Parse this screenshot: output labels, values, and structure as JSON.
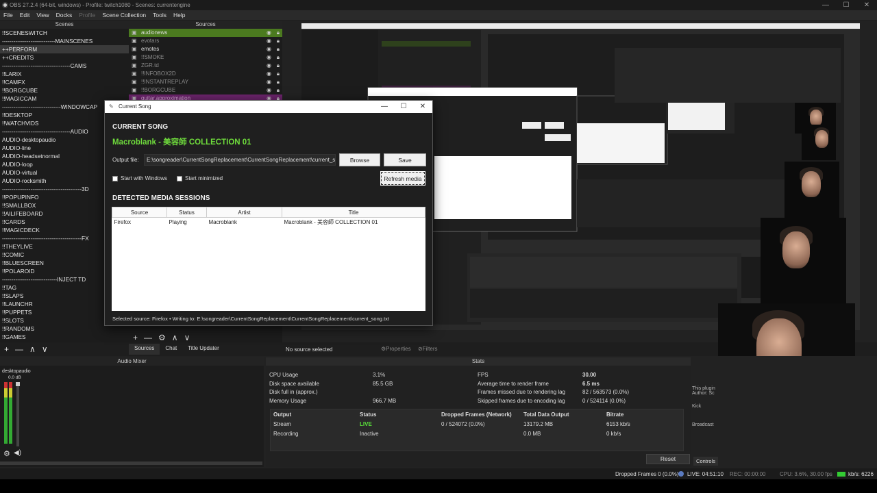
{
  "window": {
    "title": "OBS 27.2.4 (64-bit, windows) - Profile: twitch1080 - Scenes: currentengine",
    "minimize_glyph": "—",
    "maximize_glyph": "☐",
    "close_glyph": "✕"
  },
  "menu": [
    "File",
    "Edit",
    "View",
    "Docks",
    "Profile",
    "Scene Collection",
    "Tools",
    "Help"
  ],
  "scenes": {
    "header": "Scenes",
    "items": [
      "!!SCENESWITCH",
      "----------------------------MAINSCENES",
      "++PERFORM",
      "++CREDITS",
      "------------------------------------CAMS",
      "!!LARIX",
      "!!CAMFX",
      "!!BORGCUBE",
      "!!MAGICCAM",
      "-------------------------------WINDOWCAP",
      "!!DESKTOP",
      "!!WATCHVIDS",
      "------------------------------------AUDIO",
      "AUDIO-desktopaudio",
      "AUDIO-line",
      "AUDIO-headsetnormal",
      "AUDIO-loop",
      "AUDIO-virtual",
      "AUDIO-rocksmith",
      "------------------------------------------3D",
      "!!POPUPINFO",
      "!!SMALLBOX",
      "!!AILIFEBOARD",
      "!!CARDS",
      "!!MAGICDECK",
      "------------------------------------------FX",
      "!!THEYLIVE",
      "!!COMIC",
      "!!BLUESCREEN",
      "!!POLAROID",
      "-----------------------------INJECT TD",
      "!!TAG",
      "!!SLAPS",
      "!!LAUNCHR",
      "!!PUPPETS",
      "!!SLOTS",
      "!!RANDOMS",
      "!!GAMES"
    ],
    "selected_index": 2
  },
  "sources": {
    "header": "Sources",
    "items": [
      {
        "label": "audionews",
        "style": "green"
      },
      {
        "label": "evotars",
        "style": "dim"
      },
      {
        "label": "emotes",
        "style": "normal"
      },
      {
        "label": "!!SMOKE",
        "style": "dim"
      },
      {
        "label": "ZGR.td",
        "style": "dim"
      },
      {
        "label": "!!INFOBOX2D",
        "style": "dim"
      },
      {
        "label": "!!INSTANTREPLAY",
        "style": "dim"
      },
      {
        "label": "!!BORGCUBE",
        "style": "dim"
      },
      {
        "label": "guitar.approximation",
        "style": "purple"
      }
    ]
  },
  "dialog": {
    "title": "Current Song",
    "heading": "CURRENT SONG",
    "now_playing": "Macroblank - 美容師 COLLECTION 01",
    "output_label": "Output file:",
    "output_value": "E:\\songreader\\CurrentSongReplacement\\CurrentSongReplacement\\current_so",
    "browse": "Browse",
    "save": "Save",
    "start_windows": "Start with Windows",
    "start_minimized": "Start minimized",
    "refresh": "Refresh media",
    "sessions_heading": "DETECTED MEDIA SESSIONS",
    "columns": [
      "Source",
      "Status",
      "Artist",
      "Title"
    ],
    "rows": [
      {
        "source": "Firefox",
        "status": "Playing",
        "artist": "Macroblank",
        "title": "Macroblank - 美容師 COLLECTION 01"
      }
    ],
    "footer": "Selected source: Firefox  •  Writing to: E:\\songreader\\CurrentSongReplacement\\CurrentSongReplacement\\current_song.txt"
  },
  "source_toolbar": {
    "add": "+",
    "remove": "—",
    "settings": "⚙",
    "up": "∧",
    "down": "∨"
  },
  "scene_toolbar": {
    "add": "+",
    "remove": "—",
    "up": "∧",
    "down": "∨"
  },
  "dock_tabs": [
    "Sources",
    "Chat",
    "Title Updater"
  ],
  "no_source": "No source selected",
  "properties": "Properties",
  "filters": "Filters",
  "audio_mixer": {
    "header": "Audio Mixer",
    "channel": "desktopaudio",
    "level": "0.0 dB"
  },
  "stats": {
    "header": "Stats",
    "left": [
      {
        "label": "CPU Usage",
        "value": "3.1%"
      },
      {
        "label": "Disk space available",
        "value": "85.5 GB"
      },
      {
        "label": "Disk full in (approx.)",
        "value": ""
      },
      {
        "label": "Memory Usage",
        "value": "966.7 MB"
      }
    ],
    "right": [
      {
        "label": "FPS",
        "value": "30.00"
      },
      {
        "label": "Average time to render frame",
        "value": "6.5 ms"
      },
      {
        "label": "Frames missed due to rendering lag",
        "value": "82 / 563573 (0.0%)"
      },
      {
        "label": "Skipped frames due to encoding lag",
        "value": "0 / 524114 (0.0%)"
      }
    ],
    "output_columns": [
      "Output",
      "Status",
      "Dropped Frames (Network)",
      "Total Data Output",
      "Bitrate"
    ],
    "outputs": [
      {
        "name": "Stream",
        "status": "LIVE",
        "dropped": "0 / 524072 (0.0%)",
        "total": "13179.2 MB",
        "bitrate": "6153 kb/s"
      },
      {
        "name": "Recording",
        "status": "Inactive",
        "dropped": "",
        "total": "0.0 MB",
        "bitrate": "0 kb/s"
      }
    ],
    "reset": "Reset"
  },
  "side_panel": {
    "plugin": "This plugin",
    "author": "Author: Sc",
    "kick": "Kick",
    "broadcast": "Broadcast",
    "controls": "Controls"
  },
  "statusbar": {
    "dropped": "Dropped Frames 0 (0.0%)",
    "live": "LIVE: 04:51:10",
    "rec": "REC: 00:00:00",
    "cpu": "CPU: 3.6%, 30.00 fps",
    "kbps": "kb/s: 6226"
  },
  "colors": {
    "live": "#5ae23a",
    "accent_green": "#6fdc3c",
    "source_green": "#4b7a1f",
    "source_purple": "#6b246b"
  },
  "icons": {
    "eye": "eye-icon",
    "lock": "lock-icon",
    "gear": "gear-icon",
    "speaker": "speaker-icon",
    "quill": "quill-icon"
  }
}
